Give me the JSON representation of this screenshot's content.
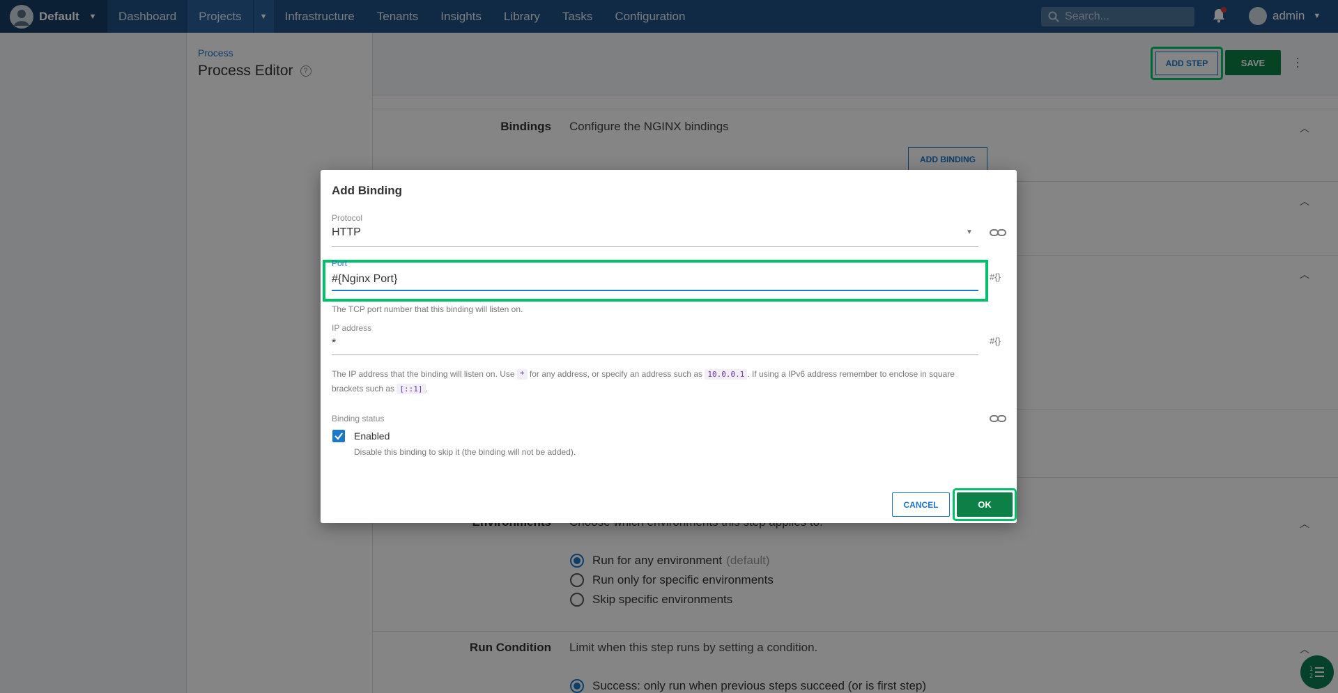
{
  "nav": {
    "space": "Default",
    "items": [
      "Dashboard",
      "Projects",
      "Infrastructure",
      "Tenants",
      "Insights",
      "Library",
      "Tasks",
      "Configuration"
    ],
    "search_placeholder": "Search...",
    "user": "admin"
  },
  "page": {
    "breadcrumb": "Process",
    "title": "Process Editor",
    "add_step": "ADD STEP",
    "save": "SAVE"
  },
  "sections": {
    "bindings_label": "Bindings",
    "bindings_desc": "Configure the NGINX bindings",
    "add_binding": "ADD BINDING",
    "environments_label": "Environments",
    "environments_desc": "Choose which environments this step applies to.",
    "env_options": [
      "Run for any environment",
      "Run only for specific environments",
      "Skip specific environments"
    ],
    "env_default_note": "(default)",
    "run_condition_label": "Run Condition",
    "run_condition_desc": "Limit when this step runs by setting a condition.",
    "run_condition_option": "Success: only run when previous steps succeed (or is first step)"
  },
  "dialog": {
    "title": "Add Binding",
    "protocol_label": "Protocol",
    "protocol_value": "HTTP",
    "port_label": "Port",
    "port_value": "#{Nginx Port}",
    "port_hint": "The TCP port number that this binding will listen on.",
    "ip_label": "IP address",
    "ip_value": "*",
    "ip_hint_1": "The IP address that the binding will listen on. Use",
    "ip_hint_code1": "*",
    "ip_hint_2": "for any address, or specify an address such as",
    "ip_hint_code2": "10.0.0.1",
    "ip_hint_3": ". If using a IPv6 address remember to enclose in square",
    "ip_hint_4": "brackets such as",
    "ip_hint_code3": "[::1]",
    "ip_hint_5": ".",
    "status_label": "Binding status",
    "enabled_label": "Enabled",
    "enabled_hint": "Disable this binding to skip it (the binding will not be added).",
    "variable_icon": "#{}",
    "cancel": "CANCEL",
    "ok": "OK"
  },
  "colors": {
    "nav": "#1f4f82",
    "accent": "#1a77ca",
    "primary_button": "#0d8047",
    "highlight": "#00c16a"
  }
}
